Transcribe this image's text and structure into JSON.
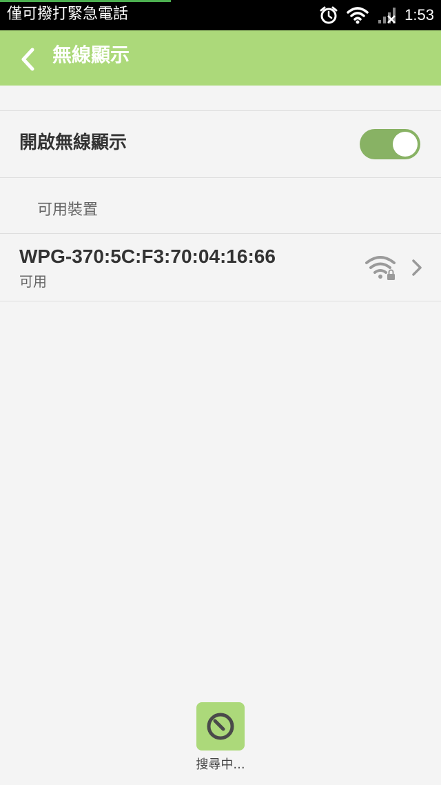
{
  "status_bar": {
    "carrier": "僅可撥打緊急電話",
    "time": "1:53",
    "icons": [
      "alarm-clock-icon",
      "wifi-icon",
      "signal-no-service-icon"
    ]
  },
  "title_bar": {
    "back_icon": "chevron-left-icon",
    "title": "無線顯示"
  },
  "wireless_display": {
    "toggle_label": "開啟無線顯示",
    "enabled": true,
    "toggle_color": "#88b264"
  },
  "available_devices": {
    "header": "可用裝置",
    "items": [
      {
        "name": "WPG-370:5C:F3:70:04:16:66",
        "status": "可用",
        "icon": "wifi-lock-icon"
      }
    ]
  },
  "search": {
    "label": "搜尋中...",
    "icon": "searching-spinner-icon"
  },
  "colors": {
    "accent": "#acd97a",
    "background": "#f4f4f4"
  }
}
